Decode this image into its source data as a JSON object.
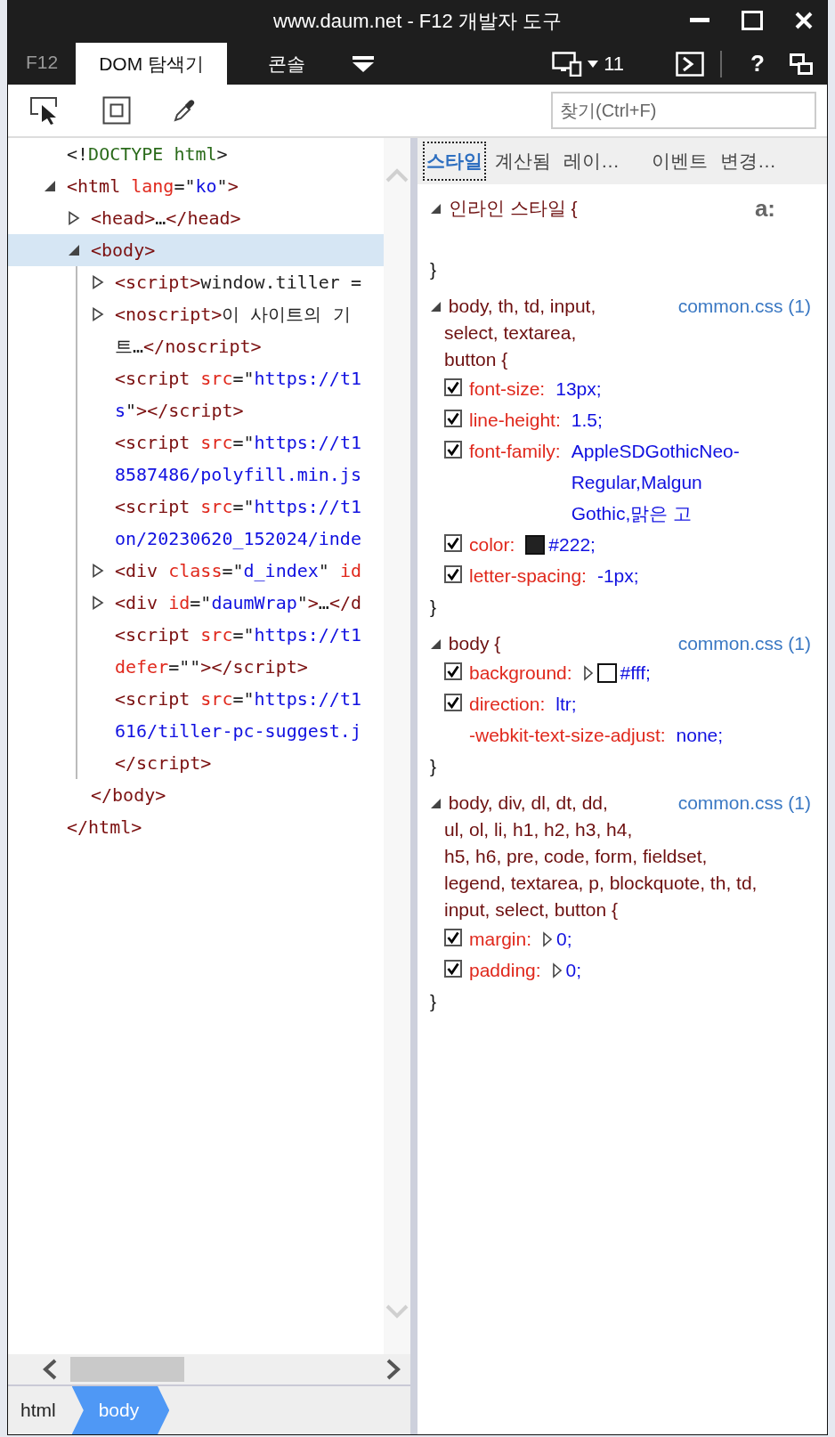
{
  "window": {
    "title": "www.daum.net - F12 개발자 도구"
  },
  "brand": "F12",
  "tabs": [
    {
      "label": "DOM 탐색기",
      "selected": true
    },
    {
      "label": "콘솔",
      "selected": false
    }
  ],
  "emulation": {
    "label": "11"
  },
  "help": "?",
  "search": {
    "placeholder": "찾기(Ctrl+F)"
  },
  "tree": [
    {
      "selected": false,
      "lines": [
        [
          {
            "kind": "punct",
            "t": "<!"
          },
          {
            "kind": "doctype",
            "t": "DOCTYPE html"
          },
          {
            "kind": "punct",
            "t": ">"
          }
        ]
      ]
    },
    {
      "selected": false,
      "expanded": true,
      "lines": [
        [
          {
            "kind": "tag",
            "t": "<html "
          },
          {
            "kind": "attr",
            "t": "lang"
          },
          {
            "kind": "punct",
            "t": "=\""
          },
          {
            "kind": "value",
            "t": "ko"
          },
          {
            "kind": "punct",
            "t": "\""
          },
          {
            "kind": "tag",
            "t": ">"
          }
        ]
      ],
      "close": [
        {
          "kind": "tag",
          "t": "</html>"
        }
      ],
      "children": [
        {
          "selected": false,
          "expanded": false,
          "lines": [
            [
              {
                "kind": "tag",
                "t": "<head>"
              },
              {
                "kind": "text",
                "t": "…"
              },
              {
                "kind": "tag",
                "t": "</head>"
              }
            ]
          ]
        },
        {
          "selected": true,
          "expanded": true,
          "lines": [
            [
              {
                "kind": "tag",
                "t": "<body>"
              }
            ]
          ],
          "close": [
            {
              "kind": "tag",
              "t": "</body>"
            }
          ],
          "children": [
            {
              "selected": false,
              "expanded": false,
              "lines": [
                [
                  {
                    "kind": "tag",
                    "t": "<script>"
                  },
                  {
                    "kind": "text",
                    "t": "window.tiller ="
                  }
                ]
              ]
            },
            {
              "selected": false,
              "expanded": false,
              "lines": [
                [
                  {
                    "kind": "tag",
                    "t": "<noscript>"
                  },
                  {
                    "kind": "text",
                    "t": "이 사이트의 기"
                  }
                ],
                [
                  {
                    "kind": "text",
                    "t": "트…"
                  },
                  {
                    "kind": "tag",
                    "t": "</noscript>"
                  }
                ]
              ]
            },
            {
              "selected": false,
              "lines": [
                [
                  {
                    "kind": "tag",
                    "t": "<script "
                  },
                  {
                    "kind": "attr",
                    "t": "src"
                  },
                  {
                    "kind": "punct",
                    "t": "=\""
                  },
                  {
                    "kind": "value",
                    "t": "https://t1"
                  }
                ],
                [
                  {
                    "kind": "value",
                    "t": "s"
                  },
                  {
                    "kind": "punct",
                    "t": "\""
                  },
                  {
                    "kind": "tag",
                    "t": "></script>"
                  }
                ]
              ]
            },
            {
              "selected": false,
              "lines": [
                [
                  {
                    "kind": "tag",
                    "t": "<script "
                  },
                  {
                    "kind": "attr",
                    "t": "src"
                  },
                  {
                    "kind": "punct",
                    "t": "=\""
                  },
                  {
                    "kind": "value",
                    "t": "https://t1"
                  }
                ],
                [
                  {
                    "kind": "value",
                    "t": "8587486/polyfill.min.js"
                  }
                ]
              ]
            },
            {
              "selected": false,
              "lines": [
                [
                  {
                    "kind": "tag",
                    "t": "<script "
                  },
                  {
                    "kind": "attr",
                    "t": "src"
                  },
                  {
                    "kind": "punct",
                    "t": "=\""
                  },
                  {
                    "kind": "value",
                    "t": "https://t1"
                  }
                ],
                [
                  {
                    "kind": "value",
                    "t": "on/20230620_152024/inde"
                  }
                ]
              ]
            },
            {
              "selected": false,
              "expanded": false,
              "lines": [
                [
                  {
                    "kind": "tag",
                    "t": "<div "
                  },
                  {
                    "kind": "attr",
                    "t": "class"
                  },
                  {
                    "kind": "punct",
                    "t": "=\""
                  },
                  {
                    "kind": "value",
                    "t": "d_index"
                  },
                  {
                    "kind": "punct",
                    "t": "\" "
                  },
                  {
                    "kind": "attr",
                    "t": "id"
                  }
                ]
              ]
            },
            {
              "selected": false,
              "expanded": false,
              "lines": [
                [
                  {
                    "kind": "tag",
                    "t": "<div "
                  },
                  {
                    "kind": "attr",
                    "t": "id"
                  },
                  {
                    "kind": "punct",
                    "t": "=\""
                  },
                  {
                    "kind": "value",
                    "t": "daumWrap"
                  },
                  {
                    "kind": "punct",
                    "t": "\""
                  },
                  {
                    "kind": "tag",
                    "t": ">"
                  },
                  {
                    "kind": "text",
                    "t": "…"
                  },
                  {
                    "kind": "tag",
                    "t": "</d"
                  }
                ]
              ]
            },
            {
              "selected": false,
              "lines": [
                [
                  {
                    "kind": "tag",
                    "t": "<script "
                  },
                  {
                    "kind": "attr",
                    "t": "src"
                  },
                  {
                    "kind": "punct",
                    "t": "=\""
                  },
                  {
                    "kind": "value",
                    "t": "https://t1"
                  }
                ],
                [
                  {
                    "kind": "attr",
                    "t": "defer"
                  },
                  {
                    "kind": "punct",
                    "t": "=\"\""
                  },
                  {
                    "kind": "tag",
                    "t": "></script>"
                  }
                ]
              ]
            },
            {
              "selected": false,
              "lines": [
                [
                  {
                    "kind": "tag",
                    "t": "<script "
                  },
                  {
                    "kind": "attr",
                    "t": "src"
                  },
                  {
                    "kind": "punct",
                    "t": "=\""
                  },
                  {
                    "kind": "value",
                    "t": "https://t1"
                  }
                ],
                [
                  {
                    "kind": "value",
                    "t": "616/tiller-pc-suggest.j"
                  }
                ],
                [
                  {
                    "kind": "tag",
                    "t": "</script>"
                  }
                ]
              ]
            }
          ]
        }
      ]
    }
  ],
  "style_tabs": [
    {
      "label": "스타일",
      "selected": true
    },
    {
      "label": "계산됨",
      "selected": false
    },
    {
      "label": "레이…",
      "selected": false
    },
    {
      "label": "이벤트",
      "selected": false
    },
    {
      "label": "변경…",
      "selected": false
    }
  ],
  "rules": [
    {
      "kind": "inline",
      "expanded": true,
      "selector": [
        "인라인 스타일 {"
      ],
      "toggle": "a:",
      "close": "}"
    },
    {
      "kind": "sheet",
      "expanded": true,
      "selector": [
        "body, th, td, input,",
        "select, textarea,",
        "button {"
      ],
      "source": "common.css (1)",
      "close": "}",
      "props": [
        {
          "kind": "toggle",
          "checked": true,
          "name": "font-size:",
          "value": [
            "13px;"
          ]
        },
        {
          "kind": "toggle",
          "checked": true,
          "name": "line-height:",
          "value": [
            "1.5;"
          ]
        },
        {
          "kind": "toggle",
          "checked": true,
          "name": "font-family:",
          "value": [
            "AppleSDGothicNeo-",
            "Regular,Malgun",
            "Gothic,맑은 고"
          ]
        },
        {
          "kind": "toggle",
          "checked": true,
          "name": "color:",
          "color": "#222222",
          "value": [
            "#222;"
          ]
        },
        {
          "kind": "toggle",
          "checked": true,
          "name": "letter-spacing:",
          "value": [
            "-1px;"
          ]
        }
      ]
    },
    {
      "kind": "sheet",
      "expanded": true,
      "selector": [
        "body {"
      ],
      "source": "common.css (1)",
      "close": "}",
      "props": [
        {
          "kind": "toggle",
          "checked": true,
          "name": "background:",
          "shorthand": true,
          "color": "#ffffff",
          "value": [
            "#fff;"
          ]
        },
        {
          "kind": "toggle",
          "checked": true,
          "name": "direction:",
          "value": [
            "ltr;"
          ]
        },
        {
          "kind": "plain",
          "name": "-webkit-text-size-adjust:",
          "value": [
            "none;"
          ]
        }
      ]
    },
    {
      "kind": "sheet",
      "expanded": true,
      "selector": [
        "body, div, dl, dt, dd,",
        "ul, ol, li, h1, h2, h3, h4,",
        "h5, h6, pre, code, form, fieldset,",
        "legend, textarea, p, blockquote, th, td,",
        "input, select, button {"
      ],
      "source": "common.css (1)",
      "close": "}",
      "props": [
        {
          "kind": "toggle",
          "checked": true,
          "name": "margin:",
          "shorthand": true,
          "value": [
            "0;"
          ]
        },
        {
          "kind": "toggle",
          "checked": true,
          "name": "padding:",
          "shorthand": true,
          "value": [
            "0;"
          ]
        }
      ]
    }
  ],
  "breadcrumb": [
    {
      "label": "html",
      "selected": false
    },
    {
      "label": "body",
      "selected": true
    }
  ]
}
